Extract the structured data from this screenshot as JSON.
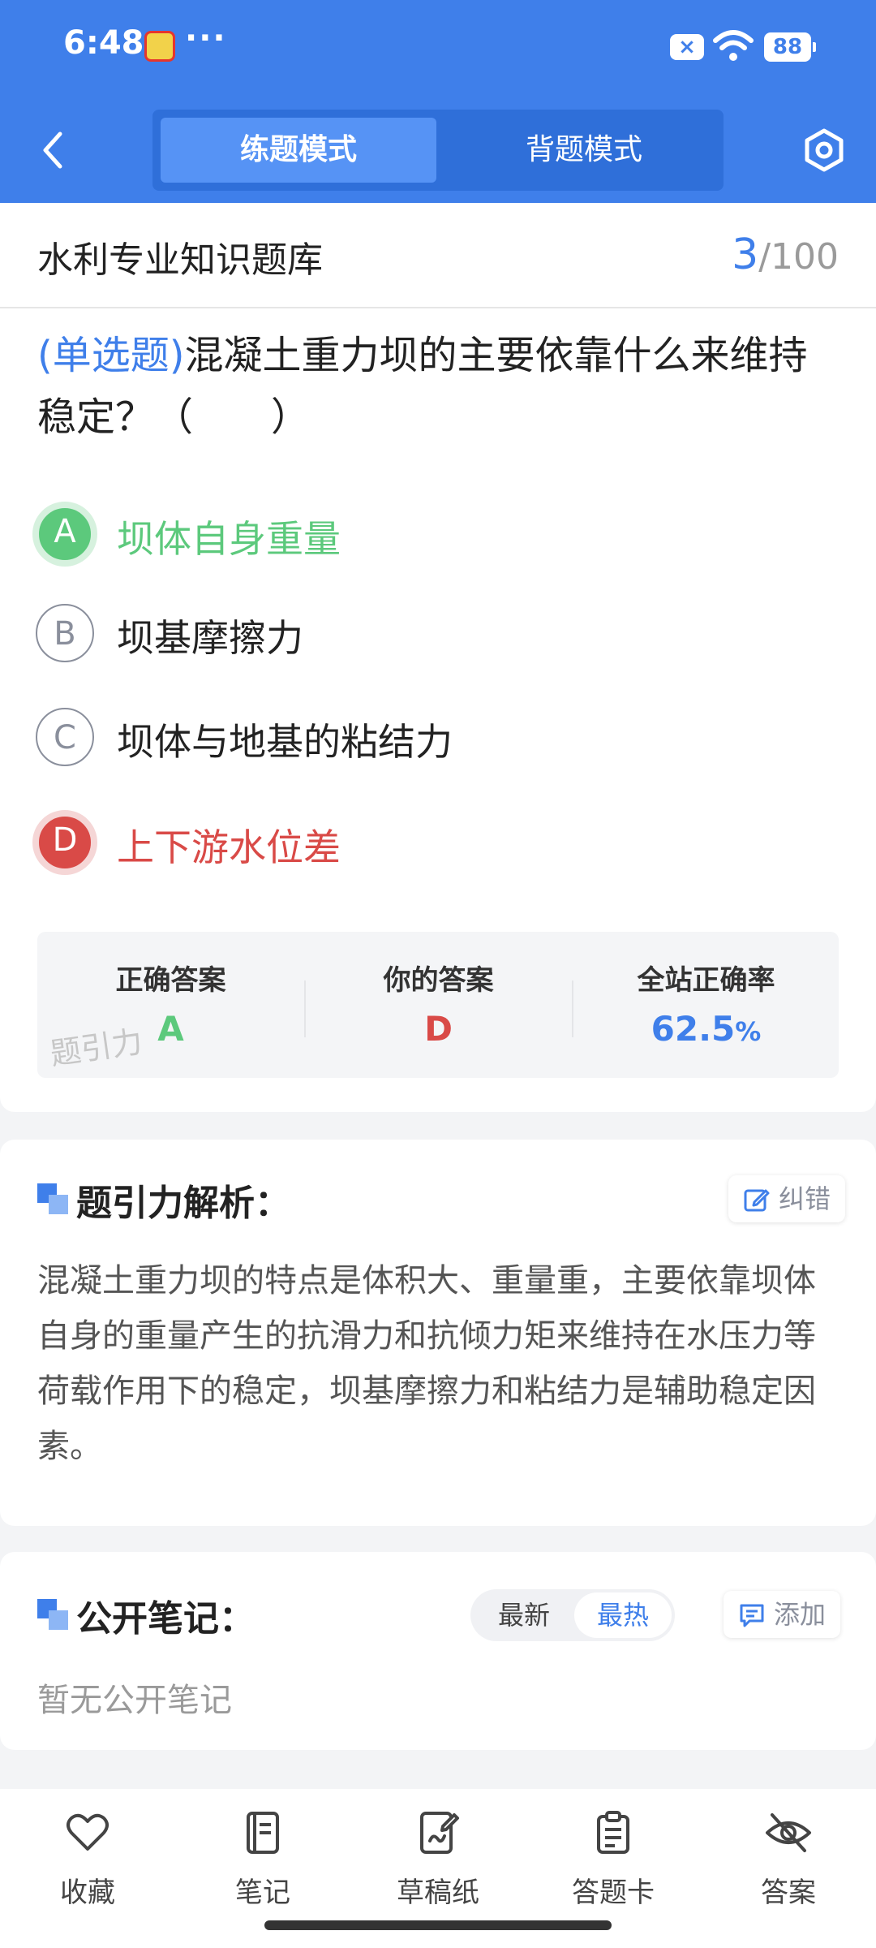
{
  "status_bar": {
    "time": "6:48",
    "more": "···",
    "x_badge": "×",
    "battery": "88"
  },
  "header": {
    "tabs": [
      {
        "label": "练题模式",
        "active": true
      },
      {
        "label": "背题模式",
        "active": false
      }
    ]
  },
  "question": {
    "bank_title": "水利专业知识题库",
    "progress_current": "3",
    "progress_total": "/100",
    "type_label": "(单选题)",
    "text": "混凝土重力坝的主要依靠什么来维持稳定？（　　）",
    "options": [
      {
        "key": "A",
        "text": "坝体自身重量",
        "state": "correct"
      },
      {
        "key": "B",
        "text": "坝基摩擦力",
        "state": "normal"
      },
      {
        "key": "C",
        "text": "坝体与地基的粘结力",
        "state": "normal"
      },
      {
        "key": "D",
        "text": "上下游水位差",
        "state": "wrong"
      }
    ]
  },
  "answer_summary": {
    "correct_label": "正确答案",
    "correct_value": "A",
    "yours_label": "你的答案",
    "yours_value": "D",
    "rate_label": "全站正确率",
    "rate_value": "62.5",
    "rate_unit": "%",
    "watermark": "题引力"
  },
  "analysis": {
    "title": "题引力解析：",
    "report_label": "纠错",
    "text": "混凝土重力坝的特点是体积大、重量重，主要依靠坝体自身的重量产生的抗滑力和抗倾力矩来维持在水压力等荷载作用下的稳定，坝基摩擦力和粘结力是辅助稳定因素。"
  },
  "notes": {
    "title": "公开笔记：",
    "sort_latest": "最新",
    "sort_hot": "最热",
    "add_label": "添加",
    "empty": "暂无公开笔记"
  },
  "bottom_nav": [
    {
      "label": "收藏",
      "icon": "heart-icon"
    },
    {
      "label": "笔记",
      "icon": "notebook-icon"
    },
    {
      "label": "草稿纸",
      "icon": "draft-icon"
    },
    {
      "label": "答题卡",
      "icon": "clipboard-icon"
    },
    {
      "label": "答案",
      "icon": "eye-off-icon"
    }
  ],
  "colors": {
    "primary": "#3f7fea",
    "correct": "#5cc97c",
    "wrong": "#d94a47"
  }
}
